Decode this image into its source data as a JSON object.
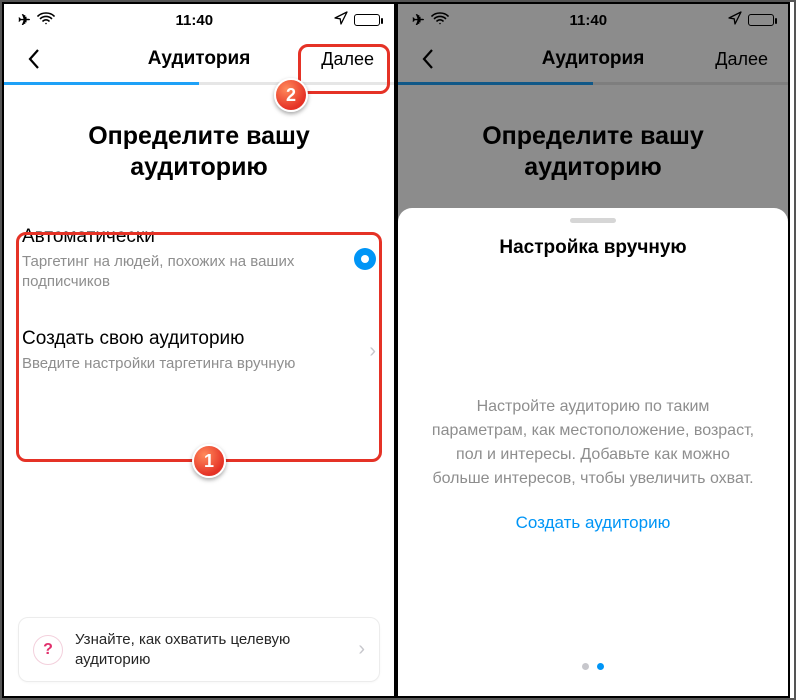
{
  "status": {
    "time": "11:40"
  },
  "left": {
    "nav": {
      "title": "Аудитория",
      "next": "Далее"
    },
    "heading": "Определите вашу аудиторию",
    "options": [
      {
        "title": "Автоматически",
        "sub": "Таргетинг на людей, похожих на ваших подписчиков",
        "selected": true
      },
      {
        "title": "Создать свою аудиторию",
        "sub": "Введите настройки таргетинга вручную",
        "selected": false
      }
    ],
    "tip": "Узнайте, как охватить целевую аудиторию",
    "badges": {
      "one": "1",
      "two": "2"
    }
  },
  "right": {
    "nav": {
      "title": "Аудитория",
      "next": "Далее"
    },
    "heading": "Определите вашу аудиторию",
    "sheet": {
      "title": "Настройка вручную",
      "desc": "Настройте аудиторию по таким параметрам, как местоположение, возраст, пол и интересы. Добавьте как можно больше интересов, чтобы увеличить охват.",
      "cta": "Создать аудиторию"
    }
  }
}
